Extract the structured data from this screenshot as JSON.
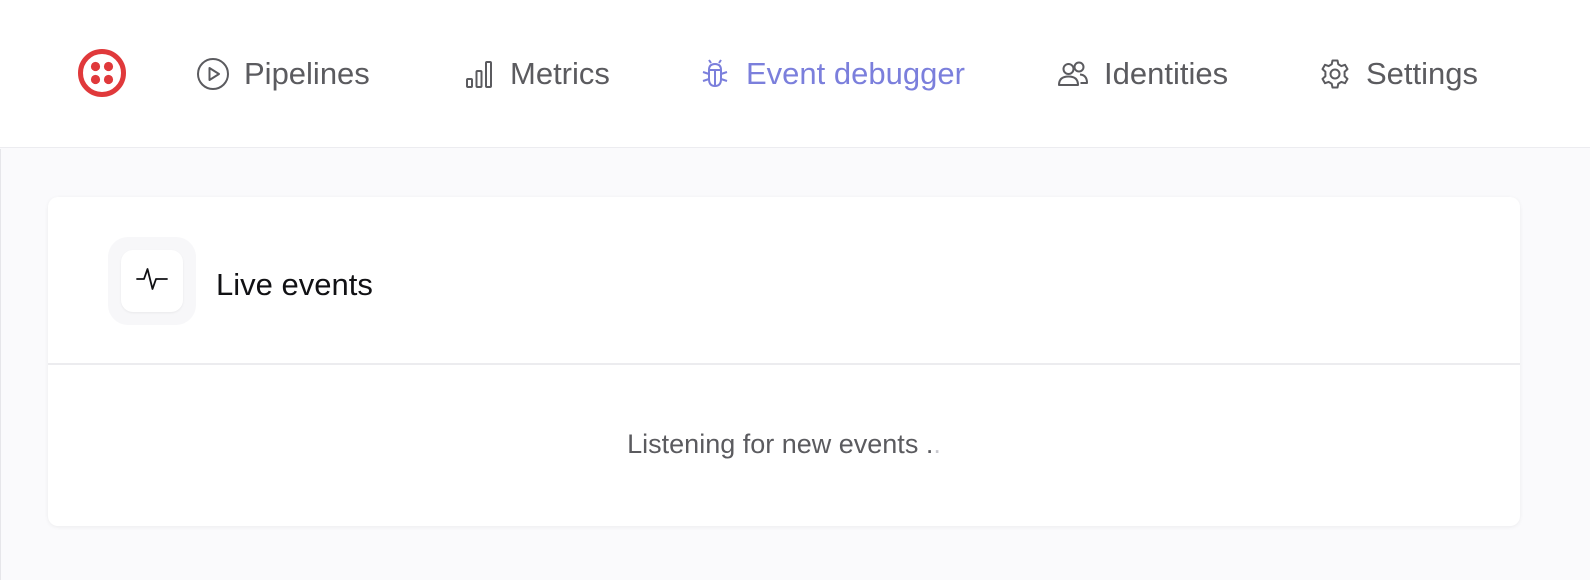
{
  "nav": {
    "items": [
      {
        "label": "Pipelines",
        "icon": "play-circle-icon",
        "active": false
      },
      {
        "label": "Metrics",
        "icon": "bar-chart-icon",
        "active": false
      },
      {
        "label": "Event debugger",
        "icon": "bug-icon",
        "active": true
      },
      {
        "label": "Identities",
        "icon": "users-icon",
        "active": false
      },
      {
        "label": "Settings",
        "icon": "gear-icon",
        "active": false
      }
    ],
    "accent_color": "#7b7fdc",
    "text_color": "#5b5b5f",
    "logo_color": "#e0393b"
  },
  "card": {
    "title": "Live events",
    "icon": "activity-icon",
    "status_text": "Listening for new events .",
    "status_trailing_dot": "."
  }
}
